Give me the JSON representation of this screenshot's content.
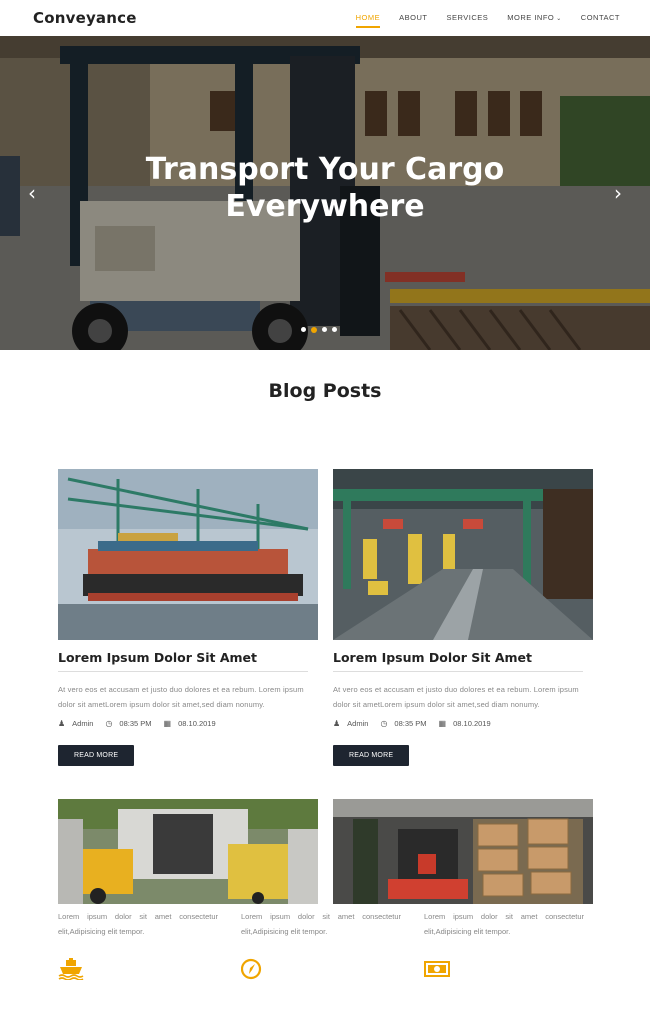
{
  "nav": {
    "brand": "Conveyance",
    "items": [
      {
        "label": "HOME",
        "active": true
      },
      {
        "label": "ABOUT"
      },
      {
        "label": "SERVICES"
      },
      {
        "label": "MORE INFO"
      },
      {
        "label": "CONTACT"
      }
    ]
  },
  "hero": {
    "title_line1": "Transport Your Cargo",
    "title_line2": "Everywhere",
    "slide_count": 4,
    "active_slide": 1
  },
  "blog": {
    "heading": "Blog Posts",
    "posts": [
      {
        "image": "cargo-ship-at-port",
        "title": "Lorem Ipsum Dolor Sit Amet",
        "text": "At vero eos et accusam et justo duo dolores et ea rebum. Lorem ipsum dolor sit ametLorem ipsum dolor sit amet,sed diam nonumy.",
        "author": "Admin",
        "time": "08:35 PM",
        "date": "08.10.2019",
        "button": "READ MORE"
      },
      {
        "image": "container-terminal-cranes",
        "title": "Lorem Ipsum Dolor Sit Amet",
        "text": "At vero eos et accusam et justo duo dolores et ea rebum. Lorem ipsum dolor sit ametLorem ipsum dolor sit amet,sed diam nonumy.",
        "author": "Admin",
        "time": "08:35 PM",
        "date": "08.10.2019",
        "button": "READ MORE"
      }
    ]
  },
  "features": [
    {
      "text": "Lorem ipsum dolor sit amet consectetur elit,Adipisicing elit tempor.",
      "icon": "ship-icon"
    },
    {
      "text": "Lorem ipsum dolor sit amet consectetur elit,Adipisicing elit tempor.",
      "icon": "compass-icon"
    },
    {
      "text": "Lorem ipsum dolor sit amet consectetur elit,Adipisicing elit tempor.",
      "icon": "money-icon"
    }
  ],
  "colors": {
    "accent": "#f0a500",
    "button": "#1e2530"
  }
}
